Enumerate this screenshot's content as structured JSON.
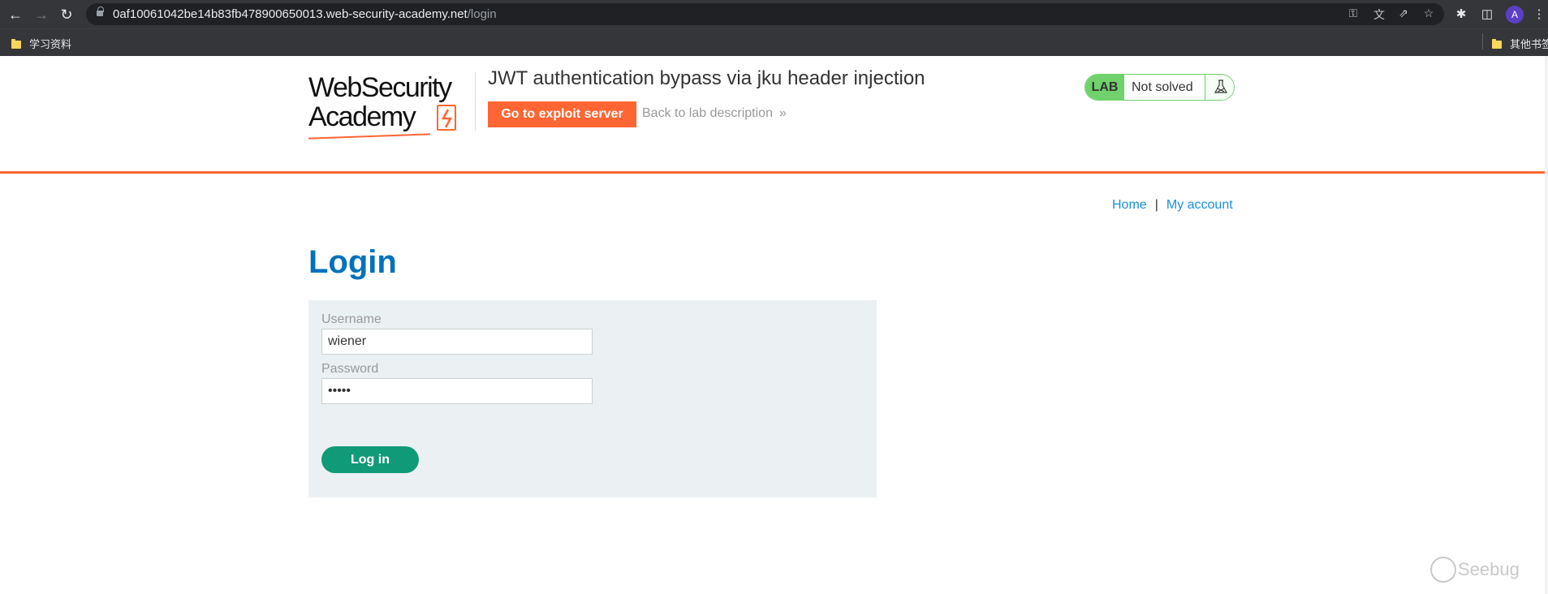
{
  "browser": {
    "url_host": "0af10061042be14b83fb478900650013.web-security-academy.net",
    "url_path": "/login",
    "profile_initial": "A",
    "bookmarks": [
      "学习资料"
    ],
    "other_bookmarks": "其他书签"
  },
  "header": {
    "logo_line1": "WebSecurity",
    "logo_line2": "Academy",
    "lab_title": "JWT authentication bypass via jku header injection",
    "exploit_button": "Go to exploit server",
    "back_link": "Back to lab description",
    "back_link_chevrons": "»",
    "status_badge": "LAB",
    "status_text": "Not solved"
  },
  "nav": {
    "home": "Home",
    "separator": "|",
    "my_account": "My account"
  },
  "login": {
    "heading": "Login",
    "username_label": "Username",
    "username_value": "wiener",
    "password_label": "Password",
    "password_value": "peter",
    "submit": "Log in"
  },
  "watermark": "Seebug",
  "colors": {
    "accent_orange": "#ff6633",
    "link_blue": "#1a8fdb",
    "heading_blue": "#0071bc",
    "status_green": "#70d16d",
    "button_teal": "#119a78",
    "panel_bg": "#ebf0f2"
  }
}
